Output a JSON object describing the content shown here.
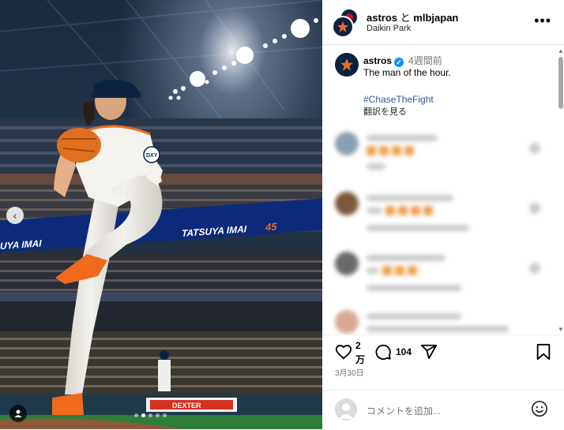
{
  "post": {
    "header_user": "astros",
    "header_connector": "と",
    "header_collab": "mlbjapan",
    "location": "Daikin Park",
    "more_icon": "more-horizontal-icon"
  },
  "caption": {
    "username": "astros",
    "verified": "✓",
    "time": "4週間前",
    "text": "The man of the hour.",
    "hashtag": "#ChaseTheFight",
    "translate": "翻訳を見る"
  },
  "photo": {
    "banner_text": "TATSUYA IMAI",
    "banner_left": "UYA IMAI",
    "banner_number": "45",
    "jersey_logo": "DXY",
    "billboard": "DEXTER"
  },
  "actions": {
    "like_icon": "heart-icon",
    "like_count": "2",
    "like_unit": "万",
    "comment_icon": "comment-icon",
    "comment_count": "104",
    "share_icon": "send-icon",
    "save_icon": "bookmark-icon",
    "date": "3月30日"
  },
  "add_comment": {
    "placeholder": "コメントを追加...",
    "emoji_icon": "smiley-icon"
  },
  "colors": {
    "brand_navy": "#0c2340",
    "link_blue": "#2c5aa0",
    "verified_blue": "#0095f6",
    "astros_orange": "#eb6e1f"
  }
}
